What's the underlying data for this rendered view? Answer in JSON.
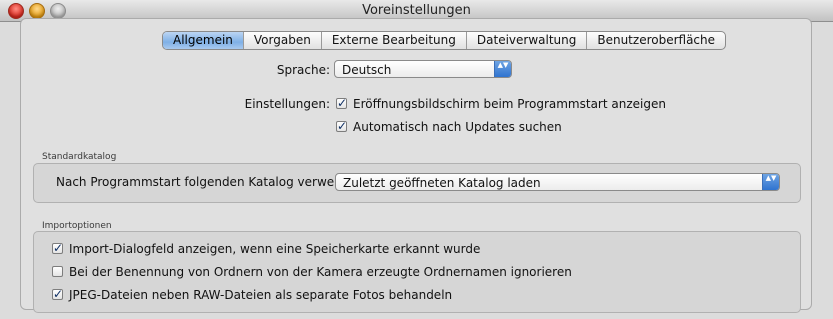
{
  "window": {
    "title": "Voreinstellungen"
  },
  "tabs": [
    {
      "label": "Allgemein",
      "active": true
    },
    {
      "label": "Vorgaben",
      "active": false
    },
    {
      "label": "Externe Bearbeitung",
      "active": false
    },
    {
      "label": "Dateiverwaltung",
      "active": false
    },
    {
      "label": "Benutzeroberfläche",
      "active": false
    }
  ],
  "general": {
    "language_label": "Sprache:",
    "language_value": "Deutsch",
    "settings_label": "Einstellungen:",
    "opt_splash": {
      "label": "Eröffnungsbildschirm beim Programmstart anzeigen",
      "checked": true
    },
    "opt_updates": {
      "label": "Automatisch nach Updates suchen",
      "checked": true
    }
  },
  "catalog": {
    "group_title": "Standardkatalog",
    "label": "Nach Programmstart folgenden Katalog verwenden:",
    "value": "Zuletzt geöffneten Katalog laden"
  },
  "import": {
    "group_title": "Importoptionen",
    "options": [
      {
        "label": "Import-Dialogfeld anzeigen, wenn eine Speicherkarte erkannt wurde",
        "checked": true
      },
      {
        "label": "Bei der Benennung von Ordnern von der Kamera erzeugte Ordnernamen ignorieren",
        "checked": false
      },
      {
        "label": "JPEG-Dateien neben RAW-Dateien als separate Fotos behandeln",
        "checked": true
      }
    ]
  },
  "icons": {
    "check": "✓",
    "popup_arrows": "▲▼"
  },
  "colors": {
    "accent": "#2f73d0",
    "tab_active": "#7fb0e6"
  }
}
